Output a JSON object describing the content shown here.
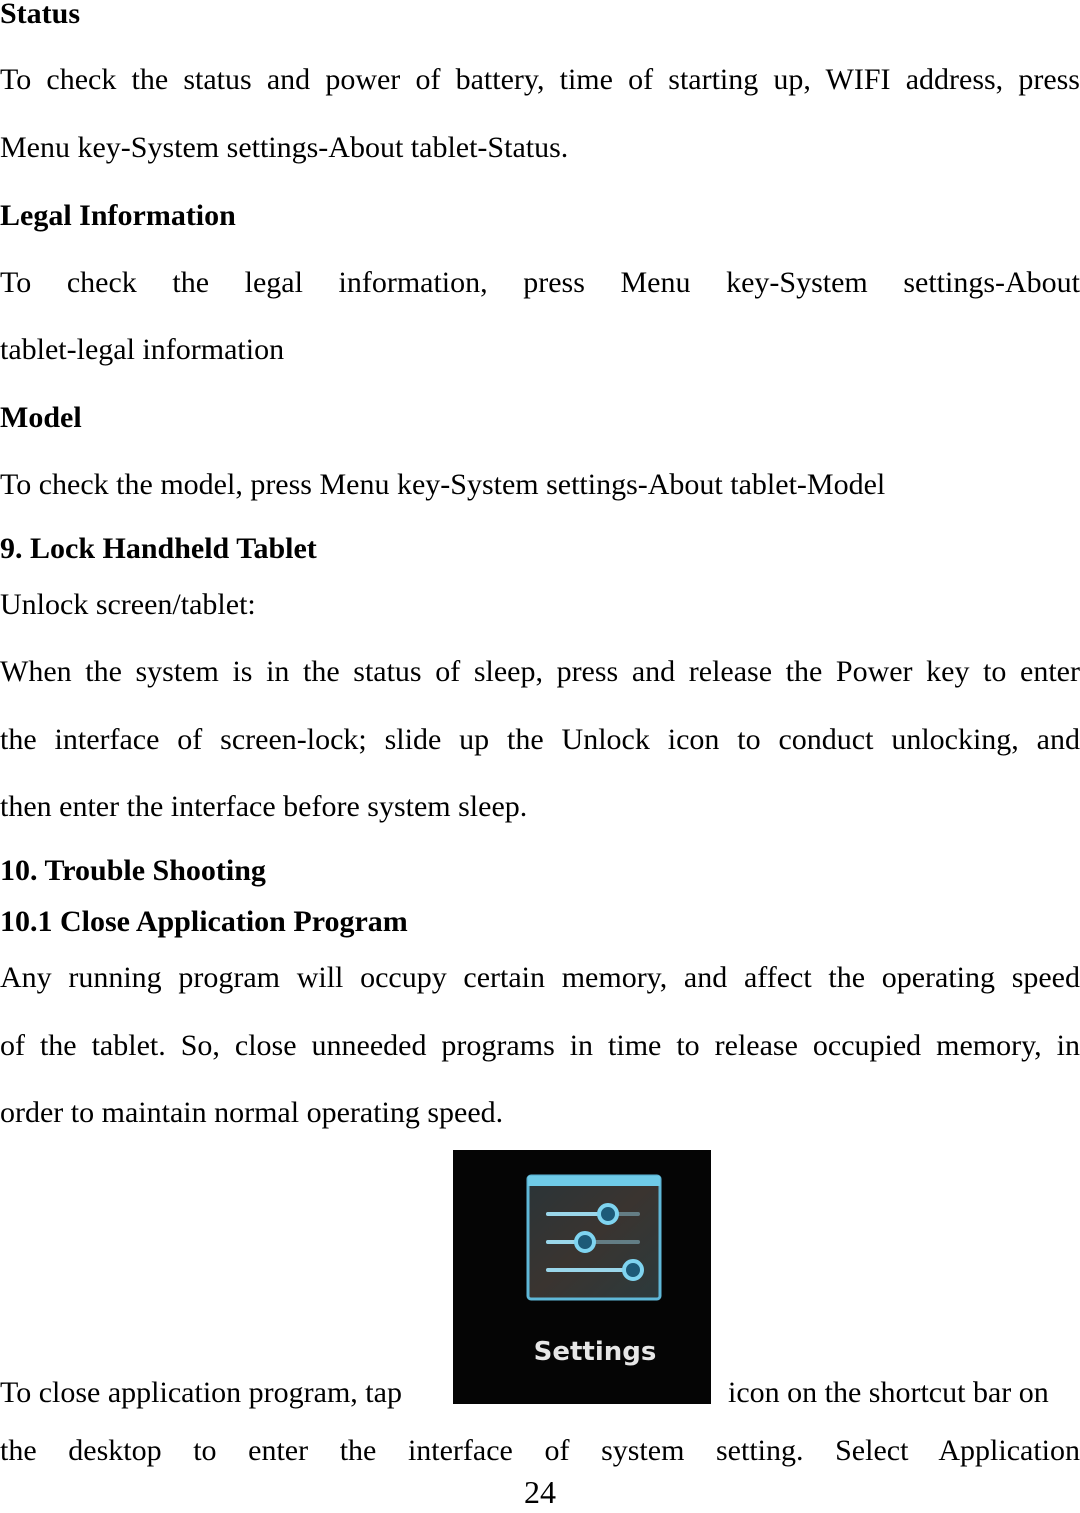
{
  "sections": {
    "status": {
      "heading": "Status",
      "line1": "To check the status and power of battery, time of starting up, WIFI address, press",
      "line2": "Menu key-System settings-About tablet-Status."
    },
    "legal": {
      "heading": "Legal Information",
      "line1": "To check the legal information, press Menu key-System settings-About",
      "line2": "tablet-legal information"
    },
    "model": {
      "heading": "Model",
      "line1": "To check the model, press Menu key-System settings-About tablet-Model"
    },
    "lock": {
      "heading": "9. Lock Handheld Tablet",
      "subheading": "Unlock screen/tablet:",
      "line1": "When the system is in the status of sleep, press and release the Power key to enter",
      "line2": "the interface of screen-lock; slide up the Unlock icon to conduct unlocking, and",
      "line3": "then enter the interface before system sleep."
    },
    "trouble": {
      "heading": "10. Trouble Shooting",
      "subheading": "10.1 Close Application Program",
      "line1": "Any running program will occupy certain memory, and affect the operating speed",
      "line2": "of the tablet. So, close unneeded programs in time to release occupied memory, in",
      "line3": "order to maintain normal operating speed.",
      "line4_before": "To close application program, tap",
      "line4_after": "icon on the shortcut bar on",
      "line5": "the desktop to enter the interface of system setting. Select Application"
    }
  },
  "settings_icon": {
    "label": "Settings",
    "icon": "settings-sliders-icon",
    "accent": "#4fc3e8"
  },
  "page_number": "24"
}
